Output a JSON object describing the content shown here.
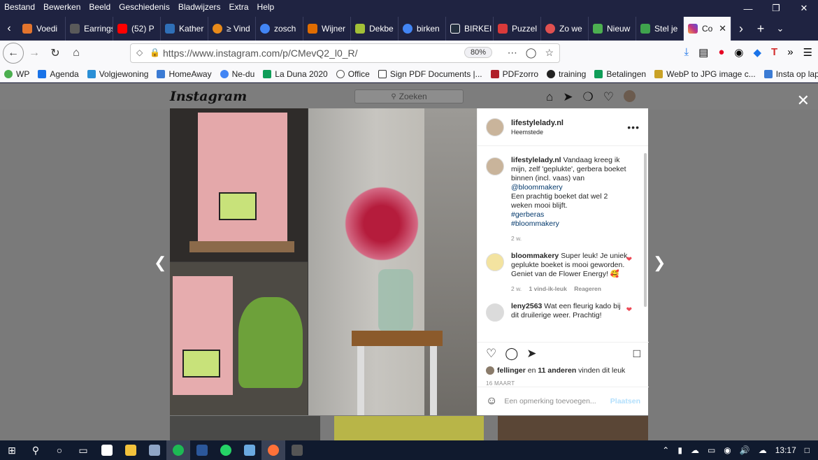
{
  "menubar": {
    "items": [
      "Bestand",
      "Bewerken",
      "Beeld",
      "Geschiedenis",
      "Bladwijzers",
      "Extra",
      "Help"
    ]
  },
  "tabs": [
    {
      "label": "Voedi",
      "color": "#e3742d"
    },
    {
      "label": "Earrings |",
      "color": "#5a5a5a"
    },
    {
      "label": "(52) P",
      "color": "#ff0000"
    },
    {
      "label": "Kather",
      "color": "#2f6fb7"
    },
    {
      "label": "≥ Vind",
      "color": "#e88a1a"
    },
    {
      "label": "zosch",
      "color": "#4285f4"
    },
    {
      "label": "Wijner",
      "color": "#e06c00"
    },
    {
      "label": "Dekbe",
      "color": "#a2c037"
    },
    {
      "label": "birken",
      "color": "#4285f4"
    },
    {
      "label": "BIRKEI",
      "color": "#232f3e"
    },
    {
      "label": "Puzzel",
      "color": "#d93a3a"
    },
    {
      "label": "Zo we",
      "color": "#e05050"
    },
    {
      "label": "Nieuw",
      "color": "#4caf50"
    },
    {
      "label": "Stel je",
      "color": "#3fa34d"
    },
    {
      "label": "Co",
      "color": "#c13584"
    }
  ],
  "nav": {
    "url": "https://www.instagram.com/p/CMevQ2_l0_R/",
    "zoom": "80%"
  },
  "bookmarks": [
    {
      "label": "WP",
      "color": "#4caf50"
    },
    {
      "label": "Agenda",
      "color": "#1a73e8"
    },
    {
      "label": "Volgjewoning",
      "color": "#2a8fd6"
    },
    {
      "label": "HomeAway",
      "color": "#3b7bd4"
    },
    {
      "label": "Ne-du",
      "color": "#4285f4"
    },
    {
      "label": "La Duna 2020",
      "color": "#0f9d58"
    },
    {
      "label": "Office",
      "color": "#555555"
    },
    {
      "label": "Sign PDF Documents |...",
      "color": "#333333"
    },
    {
      "label": "PDFzorro",
      "color": "#b0202a"
    },
    {
      "label": "training",
      "color": "#222222"
    },
    {
      "label": "Betalingen",
      "color": "#0f9d58"
    },
    {
      "label": "WebP to JPG image c...",
      "color": "#c9a227"
    },
    {
      "label": "Insta op laptop",
      "color": "#3b7bd4"
    }
  ],
  "instagram": {
    "logo": "Instagram",
    "search_placeholder": "Zoeken",
    "post": {
      "username": "lifestylelady.nl",
      "location": "Heemstede",
      "caption": {
        "user": "lifestylelady.nl",
        "text": "Vandaag kreeg ik mijn, zelf 'geplukte', gerbera boeket binnen (incl. vaas) van",
        "mention": "@bloommakery",
        "text2": "Een prachtig boeket dat wel 2 weken mooi blijft.",
        "tag1": "#gerberas",
        "tag2": "#bloommakery",
        "time": "2 w."
      },
      "comments": [
        {
          "user": "bloommakery",
          "text": "Super leuk! Je uniek geplukte boeket is mooi geworden. Geniet van de Flower Energy! 🥰",
          "time": "2 w.",
          "likes": "1 vind-ik-leuk",
          "reply": "Reageren"
        },
        {
          "user": "leny2563",
          "text": "Wat een fleurig kado bij dit druilerige weer. Prachtig!"
        }
      ],
      "likes_user": "fellinger",
      "likes_middle": "en",
      "likes_others": "11 anderen",
      "likes_suffix": "vinden dit leuk",
      "date": "16 MAART",
      "add_comment_placeholder": "Een opmerking toevoegen...",
      "post_button": "Plaatsen"
    }
  },
  "taskbar": {
    "time": "13:17"
  }
}
